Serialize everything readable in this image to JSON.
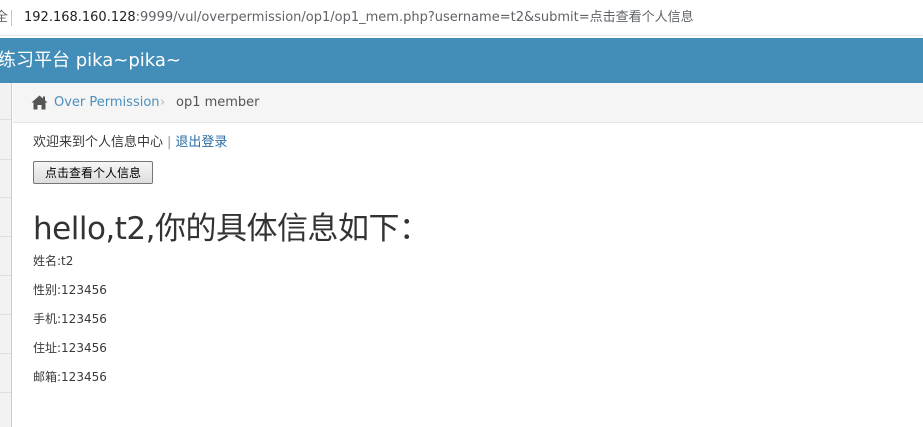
{
  "browser": {
    "security_fragment": "全",
    "url_host": "192.168.160.128",
    "url_rest": ":9999/vul/overpermission/op1/op1_mem.php?username=t2&submit=点击查看个人信息"
  },
  "navbar": {
    "brand": "练习平台 pika~pika~"
  },
  "breadcrumb": {
    "link": "Over Permission",
    "current": "op1 member"
  },
  "main": {
    "welcome_text": "欢迎来到个人信息中心",
    "separator": "|",
    "logout_label": "退出登录",
    "view_button_label": "点击查看个人信息",
    "heading": "hello,t2,你的具体信息如下：",
    "info": [
      {
        "text": "姓名:t2"
      },
      {
        "text": "性别:123456"
      },
      {
        "text": "手机:123456"
      },
      {
        "text": "住址:123456"
      },
      {
        "text": "邮箱:123456"
      }
    ]
  },
  "colors": {
    "navbar": "#438eb9",
    "link": "#4c8fbd"
  }
}
